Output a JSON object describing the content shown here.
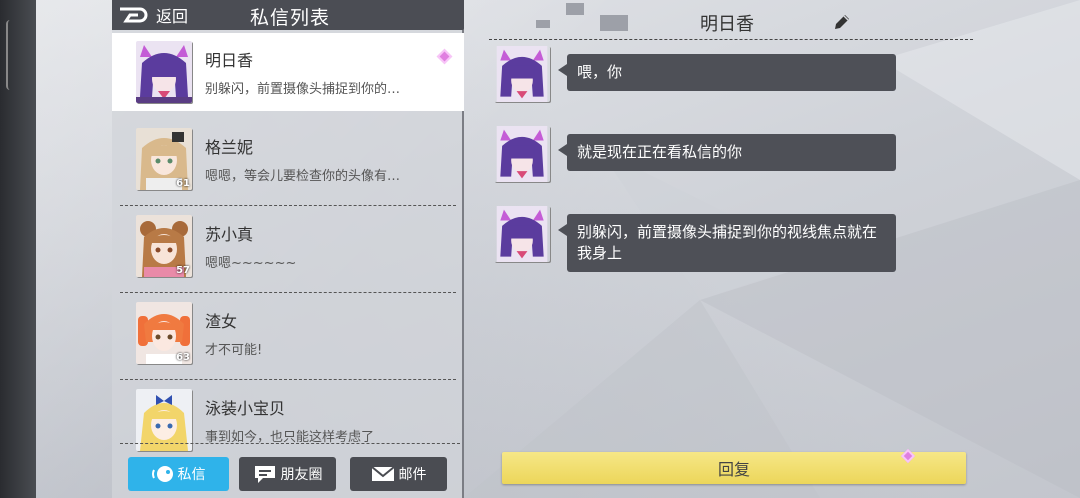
{
  "header": {
    "back_label": "返回",
    "title": "私信列表"
  },
  "conversations": [
    {
      "name": "明日香",
      "preview": "别躲闪，前置摄像头捕捉到你的…",
      "level": "",
      "active": true
    },
    {
      "name": "格兰妮",
      "preview": "嗯嗯，等会儿要检查你的头像有…",
      "level": "61"
    },
    {
      "name": "苏小真",
      "preview": "嗯嗯~~~~~~",
      "level": "57"
    },
    {
      "name": "渣女",
      "preview": "才不可能!",
      "level": "63"
    },
    {
      "name": "泳装小宝贝",
      "preview": "事到如今，也只能这样考虑了",
      "level": ""
    }
  ],
  "tabs": {
    "private_label": "私信",
    "moments_label": "朋友圈",
    "mail_label": "邮件"
  },
  "chat": {
    "title": "明日香",
    "messages": [
      {
        "text": "喂，你"
      },
      {
        "text": "就是现在正在看私信的你"
      },
      {
        "text": "别躲闪，前置摄像头捕捉到你的视线焦点就在我身上"
      }
    ],
    "reply_label": "回复"
  },
  "colors": {
    "active_tab": "#2fb3ea",
    "inactive_tab": "#4a4c52",
    "bubble": "#4e5057",
    "reply_button": "#ecd65a",
    "accent_diamond": "#e07fe0"
  }
}
